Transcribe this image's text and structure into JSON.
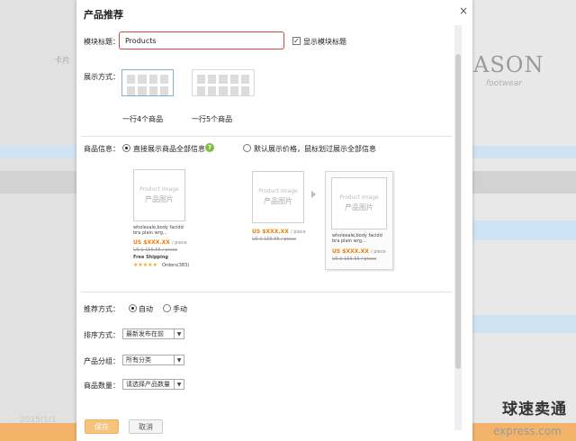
{
  "background": {
    "left_text": "卡片",
    "brand": "ASON",
    "brand_sub": "footwear",
    "bottom_text": "2015/1/1",
    "watermark_cn": "球速卖通",
    "watermark_url": "express.com"
  },
  "modal": {
    "title": "产品推荐",
    "close": "×",
    "module_title_label": "模块标题：",
    "module_title_value": "Products",
    "show_title_checkbox": {
      "label": "显示模块标题",
      "checked": true
    },
    "display_mode": {
      "label": "展示方式：",
      "options": [
        {
          "label": "一行4个商品",
          "selected": true
        },
        {
          "label": "一行5个商品",
          "selected": false
        }
      ]
    },
    "product_info": {
      "label": "商品信息：",
      "options": [
        {
          "label": "直接展示商品全部信息",
          "selected": true
        },
        {
          "label": "默认展示价格，鼠标划过展示全部信息",
          "selected": false
        }
      ],
      "help_icon": "?"
    },
    "preview": {
      "image_en": "Product Image",
      "image_cn": "产品图片",
      "title_text": "wholesale,body facidd bra plain wrg...",
      "title_text_2": "wholesale,body facidd bra plain wrg...",
      "price": "US $XXX.XX",
      "price_unit": "/ piece",
      "old_price": "US $ 155.55 / piece",
      "shipping": "Free Shipping",
      "stars": "★★★★★",
      "orders": "Orders(383)"
    },
    "recommend": {
      "label": "推荐方式：",
      "options": [
        {
          "label": "自动",
          "selected": true
        },
        {
          "label": "手动",
          "selected": false
        }
      ]
    },
    "sort": {
      "label": "排序方式：",
      "value": "最新发布在前"
    },
    "group": {
      "label": "产品分组：",
      "value": "所有分类"
    },
    "count": {
      "label": "商品数量：",
      "value": "请选择产品数量"
    },
    "buttons": {
      "save": "保存",
      "cancel": "取消"
    }
  }
}
